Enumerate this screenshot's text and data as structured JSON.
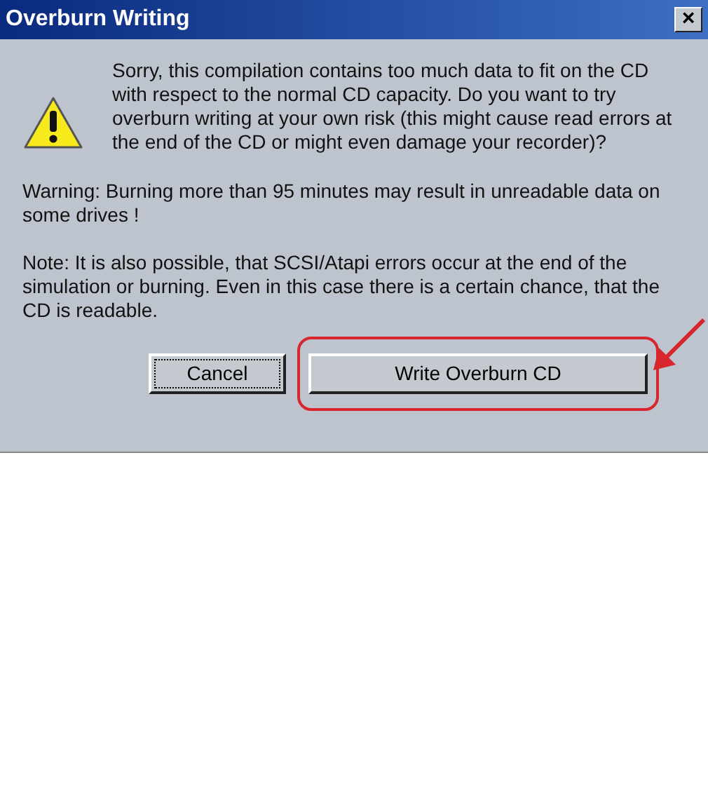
{
  "window": {
    "title": "Overburn Writing",
    "close_button": "×"
  },
  "message": "Sorry, this compilation contains too much data to fit on the CD with respect to the normal CD capacity. Do you want to try overburn writing at your own risk (this might cause read errors at the end of the CD or might even damage your recorder)?",
  "warning": "Warning: Burning more than 95 minutes may result in unreadable data on some drives !",
  "note": "Note: It is also possible, that SCSI/Atapi errors occur at the end of the simulation or burning. Even in this case there is a certain chance, that the CD is readable.",
  "buttons": [
    {
      "label": "Cancel",
      "kind": "small",
      "focused": true,
      "highlighted": false
    },
    {
      "label": "Write Overburn CD",
      "kind": "wide",
      "focused": false,
      "highlighted": true
    }
  ]
}
